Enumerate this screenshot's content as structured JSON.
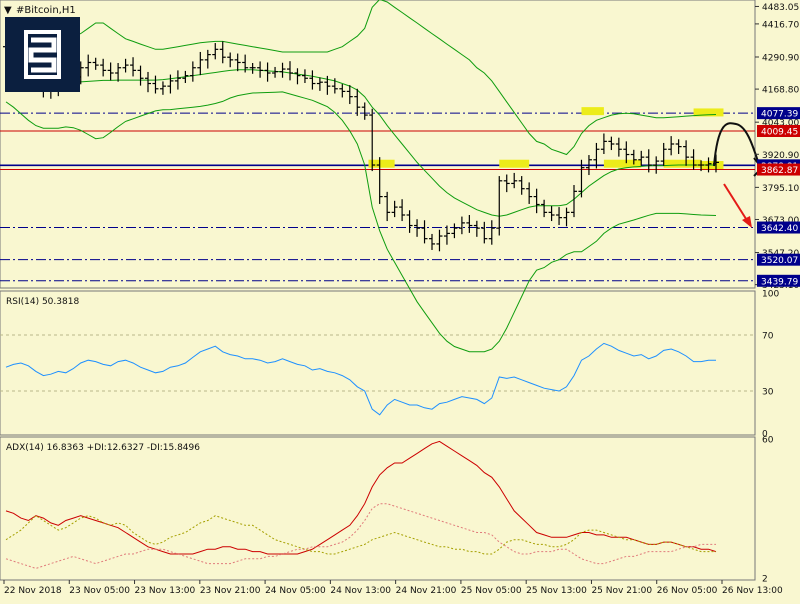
{
  "window": {
    "title": "#Bitcoin,H1"
  },
  "colors": {
    "background": "#f9f7d0",
    "grid": "#b9b78a",
    "price_line_blue": "#00008b",
    "level_red": "#cc0000",
    "bollinger": "#0f9d0f",
    "rsi_line": "#1e90ff",
    "adx_main": "#cc0000",
    "di_plus": "#a5a000",
    "di_minus": "#e07b7b",
    "highlight": "#ecec1a",
    "arrow": "#e41b17",
    "logo_bg": "#0b1f3f"
  },
  "chart_data": [
    {
      "type": "candlestick",
      "title": "#Bitcoin,H1",
      "ylim": [
        3420,
        4500
      ],
      "price_axis_labels": [
        "4483.05",
        "4416.70",
        "4290.90",
        "4168.80",
        "4043.00",
        "3920.90",
        "3795.10",
        "3673.00",
        "3547.20",
        "3425.10"
      ],
      "levels": [
        {
          "value": 4077.39,
          "label": "4077.39",
          "style": "blue-dashdot"
        },
        {
          "value": 4009.45,
          "label": "4009.45",
          "style": "red-solid"
        },
        {
          "value": 3878.81,
          "label": "3878.81",
          "style": "blue-solid"
        },
        {
          "value": 3862.87,
          "label": "3862.87",
          "style": "red-solid"
        },
        {
          "value": 3642.4,
          "label": "3642.40",
          "style": "blue-dashdot"
        },
        {
          "value": 3520.07,
          "label": "3520.07",
          "style": "blue-dashdot"
        },
        {
          "value": 3439.79,
          "label": "3439.79",
          "style": "blue-dashdot"
        }
      ],
      "close": [
        4330,
        4320,
        4290,
        4240,
        4180,
        4160,
        4175,
        4200,
        4190,
        4215,
        4250,
        4270,
        4260,
        4240,
        4230,
        4250,
        4260,
        4240,
        4210,
        4190,
        4170,
        4180,
        4200,
        4210,
        4220,
        4250,
        4280,
        4300,
        4320,
        4290,
        4280,
        4270,
        4250,
        4250,
        4240,
        4230,
        4235,
        4245,
        4230,
        4220,
        4210,
        4190,
        4195,
        4180,
        4170,
        4160,
        4140,
        4100,
        4070,
        3880,
        3760,
        3700,
        3720,
        3690,
        3650,
        3640,
        3600,
        3580,
        3610,
        3620,
        3640,
        3660,
        3650,
        3640,
        3600,
        3640,
        3820,
        3810,
        3820,
        3790,
        3760,
        3730,
        3700,
        3690,
        3680,
        3700,
        3780,
        3870,
        3900,
        3940,
        3970,
        3960,
        3940,
        3920,
        3900,
        3910,
        3880,
        3895,
        3940,
        3960,
        3950,
        3910,
        3880,
        3880,
        3885,
        3890
      ],
      "bollinger_upper": [
        4340,
        4350,
        4370,
        4390,
        4400,
        4400,
        4390,
        4380,
        4370,
        4370,
        4380,
        4400,
        4420,
        4420,
        4400,
        4380,
        4360,
        4350,
        4340,
        4330,
        4320,
        4320,
        4325,
        4330,
        4335,
        4340,
        4345,
        4348,
        4350,
        4350,
        4345,
        4340,
        4335,
        4330,
        4325,
        4320,
        4315,
        4310,
        4310,
        4310,
        4310,
        4310,
        4310,
        4310,
        4320,
        4330,
        4350,
        4370,
        4400,
        4480,
        4510,
        4500,
        4480,
        4460,
        4440,
        4420,
        4400,
        4380,
        4360,
        4340,
        4320,
        4300,
        4280,
        4250,
        4230,
        4200,
        4160,
        4120,
        4080,
        4040,
        4000,
        3970,
        3960,
        3940,
        3930,
        3920,
        3950,
        4000,
        4030,
        4050,
        4060,
        4070,
        4075,
        4077,
        4075,
        4070,
        4065,
        4060,
        4060,
        4062,
        4064,
        4066,
        4068,
        4070,
        4071,
        4072
      ],
      "bollinger_middle": [
        4230,
        4225,
        4222,
        4220,
        4215,
        4210,
        4205,
        4200,
        4198,
        4196,
        4196,
        4198,
        4200,
        4202,
        4202,
        4203,
        4203,
        4203,
        4203,
        4203,
        4203,
        4205,
        4208,
        4212,
        4216,
        4220,
        4224,
        4228,
        4232,
        4236,
        4240,
        4242,
        4242,
        4242,
        4240,
        4238,
        4236,
        4234,
        4230,
        4226,
        4222,
        4218,
        4212,
        4206,
        4200,
        4190,
        4180,
        4165,
        4140,
        4100,
        4070,
        4030,
        3995,
        3960,
        3925,
        3890,
        3860,
        3830,
        3800,
        3775,
        3755,
        3740,
        3725,
        3710,
        3700,
        3690,
        3685,
        3690,
        3700,
        3710,
        3720,
        3725,
        3725,
        3725,
        3725,
        3730,
        3750,
        3775,
        3800,
        3820,
        3840,
        3855,
        3865,
        3870,
        3873,
        3875,
        3877,
        3878,
        3878,
        3879,
        3880,
        3880,
        3880,
        3880,
        3880,
        3880
      ],
      "bollinger_lower": [
        4120,
        4100,
        4075,
        4050,
        4030,
        4020,
        4020,
        4020,
        4025,
        4022,
        4012,
        3996,
        3980,
        3984,
        4004,
        4026,
        4046,
        4056,
        4066,
        4076,
        4086,
        4090,
        4091,
        4094,
        4097,
        4100,
        4103,
        4108,
        4114,
        4122,
        4135,
        4144,
        4149,
        4154,
        4155,
        4156,
        4157,
        4158,
        4150,
        4142,
        4134,
        4126,
        4114,
        4102,
        4080,
        4050,
        4010,
        3960,
        3880,
        3720,
        3630,
        3560,
        3510,
        3460,
        3410,
        3360,
        3320,
        3280,
        3240,
        3210,
        3190,
        3180,
        3170,
        3170,
        3170,
        3180,
        3210,
        3260,
        3320,
        3380,
        3440,
        3480,
        3490,
        3510,
        3520,
        3540,
        3550,
        3550,
        3570,
        3590,
        3620,
        3640,
        3655,
        3663,
        3671,
        3680,
        3689,
        3696,
        3696,
        3696,
        3696,
        3694,
        3692,
        3690,
        3689,
        3688
      ]
    },
    {
      "type": "line",
      "title": "RSI(14) 50.3818",
      "ylim": [
        0,
        100
      ],
      "axis_labels": [
        "100",
        "70",
        "30",
        "0"
      ],
      "levels": [
        70,
        30
      ],
      "series": [
        {
          "values": [
            47,
            49,
            50,
            48,
            44,
            41,
            42,
            44,
            43,
            46,
            50,
            52,
            51,
            49,
            48,
            51,
            52,
            50,
            47,
            45,
            43,
            44,
            47,
            48,
            50,
            54,
            58,
            60,
            62,
            58,
            56,
            55,
            53,
            53,
            52,
            50,
            51,
            53,
            51,
            49,
            48,
            45,
            46,
            44,
            43,
            41,
            38,
            33,
            30,
            17,
            13,
            20,
            24,
            22,
            20,
            20,
            18,
            17,
            21,
            22,
            24,
            26,
            25,
            24,
            21,
            25,
            40,
            39,
            40,
            38,
            36,
            34,
            32,
            31,
            30,
            33,
            41,
            52,
            55,
            60,
            64,
            62,
            59,
            57,
            55,
            56,
            53,
            55,
            59,
            60,
            58,
            55,
            51,
            51,
            52,
            52
          ]
        }
      ]
    },
    {
      "type": "line",
      "title": "ADX(14) 16.8363 +DI:12.6327 -DI:15.8496",
      "ylim": [
        2,
        60
      ],
      "axis_labels": [
        "60",
        "2"
      ],
      "series": [
        {
          "values": [
            30,
            29,
            27,
            26,
            28,
            27,
            25,
            24,
            26,
            27,
            28,
            27,
            26,
            25,
            24,
            23,
            21,
            19,
            17,
            15,
            14,
            13,
            12,
            12,
            12,
            12,
            13,
            14,
            14,
            15,
            15,
            14,
            14,
            13,
            13,
            12,
            12,
            12,
            12,
            12,
            13,
            14,
            16,
            18,
            20,
            22,
            24,
            28,
            33,
            40,
            45,
            48,
            50,
            50,
            52,
            54,
            56,
            58,
            59,
            57,
            55,
            53,
            51,
            49,
            46,
            44,
            40,
            35,
            30,
            27,
            24,
            21,
            20,
            19,
            19,
            19,
            20,
            21,
            21,
            20,
            20,
            19,
            19,
            19,
            18,
            17,
            16,
            16,
            17,
            17,
            16,
            15,
            15,
            14,
            14,
            13
          ]
        },
        {
          "values": [
            18,
            20,
            22,
            25,
            28,
            26,
            24,
            22,
            23,
            25,
            27,
            28,
            27,
            25,
            24,
            25,
            24,
            21,
            19,
            17,
            16,
            17,
            19,
            20,
            21,
            23,
            25,
            26,
            28,
            27,
            26,
            25,
            24,
            24,
            22,
            20,
            18,
            17,
            16,
            15,
            14,
            13,
            13,
            12,
            12,
            13,
            14,
            15,
            16,
            18,
            19,
            20,
            21,
            20,
            19,
            18,
            17,
            16,
            15,
            15,
            14,
            14,
            13,
            13,
            12,
            12,
            14,
            17,
            18,
            18,
            17,
            16,
            16,
            15,
            15,
            16,
            18,
            21,
            22,
            22,
            21,
            20,
            19,
            18,
            18,
            17,
            16,
            16,
            17,
            17,
            16,
            15,
            14,
            13,
            13,
            13
          ]
        },
        {
          "values": [
            10,
            9,
            8,
            7,
            6,
            7,
            8,
            9,
            10,
            11,
            10,
            9,
            8,
            9,
            10,
            11,
            12,
            12,
            13,
            14,
            14,
            14,
            13,
            12,
            11,
            10,
            9,
            8,
            8,
            8,
            8,
            9,
            10,
            10,
            10,
            11,
            11,
            12,
            13,
            14,
            14,
            15,
            15,
            15,
            16,
            17,
            19,
            22,
            26,
            31,
            33,
            33,
            32,
            31,
            30,
            29,
            28,
            27,
            26,
            25,
            24,
            23,
            22,
            21,
            21,
            20,
            17,
            15,
            13,
            12,
            12,
            13,
            13,
            13,
            14,
            14,
            12,
            10,
            9,
            8,
            8,
            9,
            10,
            11,
            11,
            12,
            13,
            13,
            13,
            13,
            14,
            15,
            15,
            16,
            16,
            16
          ]
        }
      ]
    }
  ],
  "time_axis": {
    "labels": [
      "22 Nov 2018",
      "23 Nov 05:00",
      "23 Nov 13:00",
      "23 Nov 21:00",
      "24 Nov 05:00",
      "24 Nov 13:00",
      "24 Nov 21:00",
      "25 Nov 05:00",
      "25 Nov 13:00",
      "25 Nov 21:00",
      "26 Nov 05:00",
      "26 Nov 13:00"
    ]
  },
  "annotations": {
    "icon": "logo-icon"
  }
}
